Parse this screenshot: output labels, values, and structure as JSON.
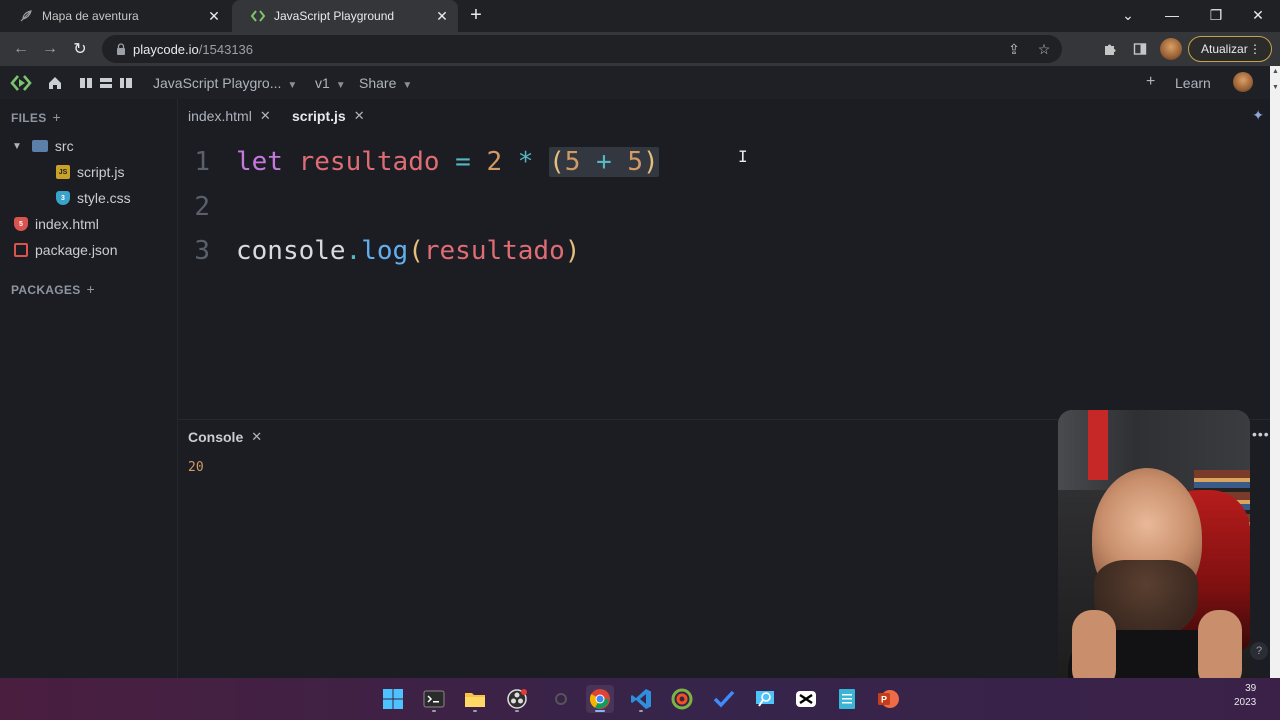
{
  "browser": {
    "tabs": [
      {
        "title": "Mapa de aventura",
        "icon": "feather-icon",
        "active": false
      },
      {
        "title": "JavaScript Playground",
        "icon": "playcode-logo-icon",
        "active": true
      }
    ],
    "address": {
      "domain": "playcode.io",
      "path": "/1543136"
    },
    "update_button": "Atualizar"
  },
  "app": {
    "project_name": "JavaScript Playgro...",
    "version": "v1",
    "share": "Share",
    "learn": "Learn"
  },
  "sidebar": {
    "files_header": "FILES",
    "packages_header": "PACKAGES",
    "tree": [
      {
        "name": "src",
        "type": "folder"
      },
      {
        "name": "script.js",
        "type": "js"
      },
      {
        "name": "style.css",
        "type": "css"
      },
      {
        "name": "index.html",
        "type": "html"
      },
      {
        "name": "package.json",
        "type": "json"
      }
    ]
  },
  "editor": {
    "tabs": [
      {
        "label": "index.html",
        "active": false
      },
      {
        "label": "script.js",
        "active": true
      }
    ],
    "lines": [
      {
        "number": "1",
        "tokens": {
          "kw": "let",
          "var": "resultado",
          "eq": "=",
          "num1": "2",
          "mul": "*",
          "open": "(",
          "a": "5",
          "plus": "+",
          "b": "5",
          "close": ")"
        }
      },
      {
        "number": "2"
      },
      {
        "number": "3",
        "tokens": {
          "obj": "console",
          "dot": ".",
          "fn": "log",
          "open": "(",
          "arg": "resultado",
          "close": ")"
        }
      }
    ]
  },
  "console": {
    "title": "Console",
    "output": "20"
  },
  "taskbar": {
    "apps": [
      "windows-start-icon",
      "terminal-icon",
      "file-explorer-icon",
      "obs-icon",
      "app-icon",
      "chrome-icon",
      "vscode-icon",
      "app-icon",
      "todo-icon",
      "search-app-icon",
      "capcut-icon",
      "notepad-icon",
      "powerpoint-icon"
    ],
    "clock_time": "39",
    "clock_year": "2023"
  },
  "colors": {
    "keyword": "#c678dd",
    "variable": "#e06c75",
    "operator": "#56b6c2",
    "number": "#d19a66",
    "paren": "#e5c07b",
    "function": "#61afef",
    "update_border": "#c6a34b"
  }
}
